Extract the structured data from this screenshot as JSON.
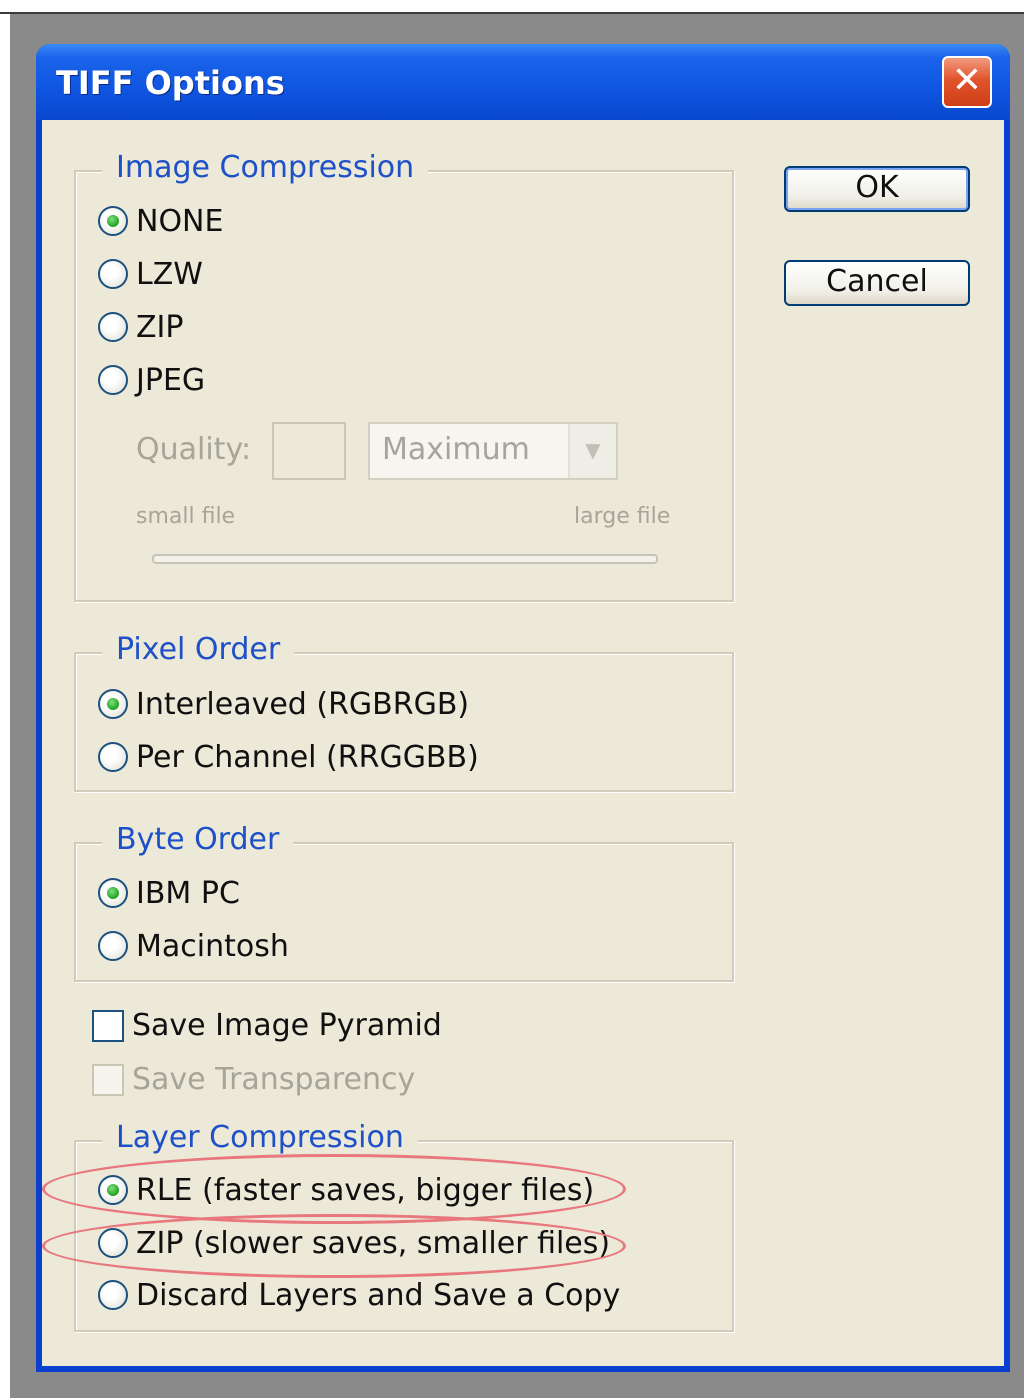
{
  "dialog": {
    "title": "TIFF Options",
    "close_symbol": "✕"
  },
  "buttons": {
    "ok": "OK",
    "cancel": "Cancel"
  },
  "image_compression": {
    "legend": "Image Compression",
    "options": [
      "NONE",
      "LZW",
      "ZIP",
      "JPEG"
    ],
    "selected": "NONE",
    "quality_label": "Quality:",
    "quality_value": "",
    "quality_preset": "Maximum",
    "slider_min_label": "small file",
    "slider_max_label": "large file"
  },
  "pixel_order": {
    "legend": "Pixel Order",
    "options": [
      "Interleaved (RGBRGB)",
      "Per Channel (RRGGBB)"
    ],
    "selected": "Interleaved (RGBRGB)"
  },
  "byte_order": {
    "legend": "Byte Order",
    "options": [
      "IBM PC",
      "Macintosh"
    ],
    "selected": "IBM PC"
  },
  "checkboxes": {
    "save_image_pyramid": {
      "label": "Save Image Pyramid",
      "checked": false,
      "enabled": true
    },
    "save_transparency": {
      "label": "Save Transparency",
      "checked": false,
      "enabled": false
    }
  },
  "layer_compression": {
    "legend": "Layer Compression",
    "options": [
      "RLE (faster saves, bigger files)",
      "ZIP (slower saves, smaller files)",
      "Discard Layers and Save a Copy"
    ],
    "selected": "RLE (faster saves, bigger files)"
  },
  "colors": {
    "titlebar": "#0f55e0",
    "client_bg": "#ece9d8",
    "group_label": "#1e50c8",
    "annotation": "#e8777e",
    "close_button": "#e0542c"
  }
}
